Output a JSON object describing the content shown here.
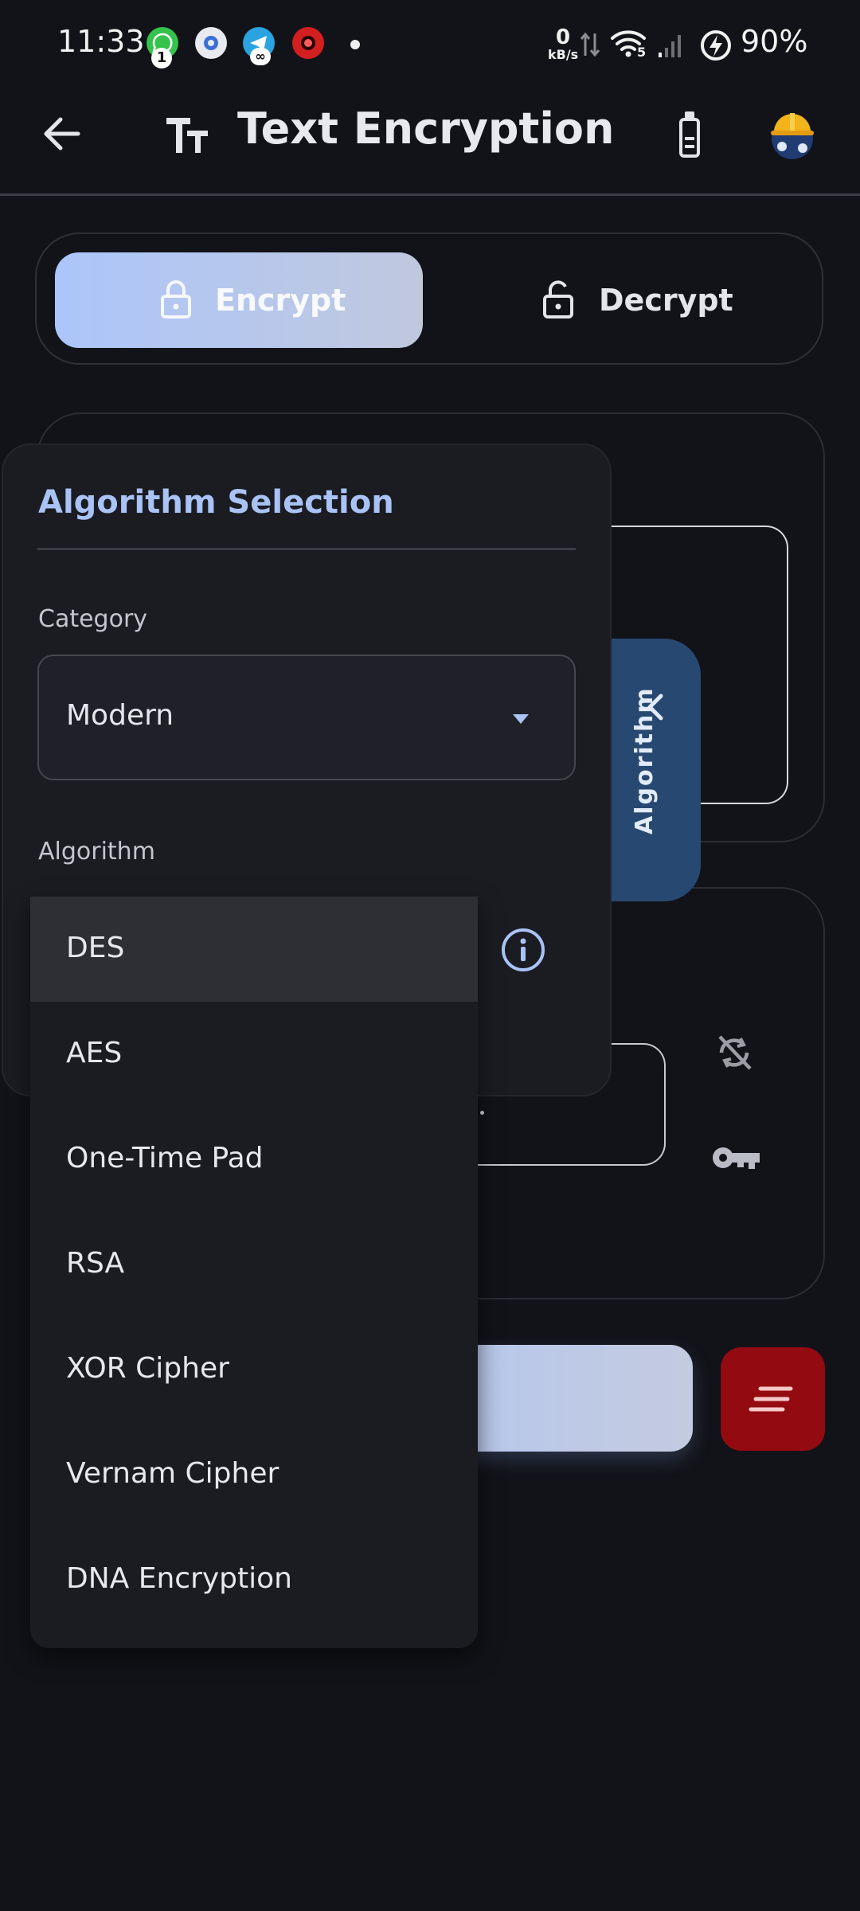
{
  "status_bar": {
    "time": "11:33",
    "net_speed_value": "0",
    "net_speed_unit": "kB/s",
    "wifi_level": "5",
    "battery": "90%",
    "whatsapp_badge": "1"
  },
  "app_bar": {
    "title": "Text Encryption"
  },
  "mode_toggle": {
    "encrypt_label": "Encrypt",
    "decrypt_label": "Decrypt"
  },
  "panel": {
    "title": "Algorithm Selection",
    "category_label": "Category",
    "category_value": "Modern",
    "algorithm_label": "Algorithm",
    "tab_label": "Algorithm"
  },
  "dropdown": {
    "selected": "DES",
    "items": [
      "DES",
      "AES",
      "One-Time Pad",
      "RSA",
      "XOR Cipher",
      "Vernam Cipher",
      "DNA Encryption"
    ]
  },
  "colors": {
    "background": "#121319",
    "accent": "#a9c3f6",
    "tab": "#274870",
    "danger": "#930a10"
  }
}
